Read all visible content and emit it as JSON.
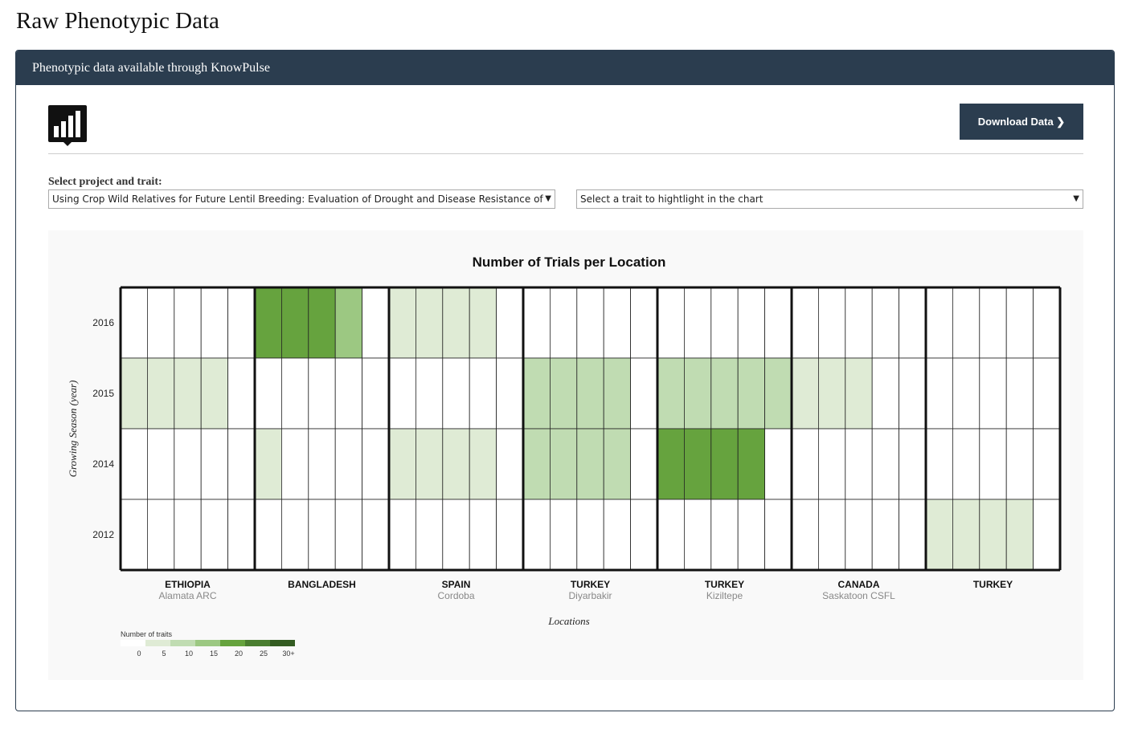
{
  "page": {
    "title": "Raw Phenotypic Data"
  },
  "panel": {
    "header": "Phenotypic data available through KnowPulse"
  },
  "toolbar": {
    "download_label": "Download Data ❯",
    "logo_icon": "bar-chart-icon"
  },
  "form": {
    "label": "Select project and trait:",
    "project_value": "Using Crop Wild Relatives for Future Lentil Breeding: Evaluation of Drought and Disease Resistance of",
    "trait_value": "Select a trait to hightlight in the chart"
  },
  "chart_data": {
    "type": "heatmap",
    "title": "Number of Trials per Location",
    "xlabel": "Locations",
    "ylabel": "Growing Season (year)",
    "years": [
      "2016",
      "2015",
      "2014",
      "2012"
    ],
    "columns_per_location": 5,
    "locations": [
      {
        "country": "ETHIOPIA",
        "site": "Alamata ARC",
        "values": [
          [
            0,
            0,
            0,
            0,
            0
          ],
          [
            5,
            5,
            5,
            5,
            0
          ],
          [
            0,
            0,
            0,
            0,
            0
          ],
          [
            0,
            0,
            0,
            0,
            0
          ]
        ]
      },
      {
        "country": "BANGLADESH",
        "site": "",
        "values": [
          [
            20,
            20,
            20,
            15,
            0
          ],
          [
            0,
            0,
            0,
            0,
            0
          ],
          [
            5,
            0,
            0,
            0,
            0
          ],
          [
            0,
            0,
            0,
            0,
            0
          ]
        ]
      },
      {
        "country": "SPAIN",
        "site": "Cordoba",
        "values": [
          [
            5,
            5,
            5,
            5,
            0
          ],
          [
            0,
            0,
            0,
            0,
            0
          ],
          [
            5,
            5,
            5,
            5,
            0
          ],
          [
            0,
            0,
            0,
            0,
            0
          ]
        ]
      },
      {
        "country": "TURKEY",
        "site": "Diyarbakir",
        "values": [
          [
            0,
            0,
            0,
            0,
            0
          ],
          [
            10,
            10,
            10,
            10,
            0
          ],
          [
            10,
            10,
            10,
            10,
            0
          ],
          [
            0,
            0,
            0,
            0,
            0
          ]
        ]
      },
      {
        "country": "TURKEY",
        "site": "Kiziltepe",
        "values": [
          [
            0,
            0,
            0,
            0,
            0
          ],
          [
            10,
            10,
            10,
            10,
            10
          ],
          [
            20,
            20,
            20,
            20,
            0
          ],
          [
            0,
            0,
            0,
            0,
            0
          ]
        ]
      },
      {
        "country": "CANADA",
        "site": "Saskatoon CSFL",
        "values": [
          [
            0,
            0,
            0,
            0,
            0
          ],
          [
            5,
            5,
            5,
            0,
            0
          ],
          [
            0,
            0,
            0,
            0,
            0
          ],
          [
            0,
            0,
            0,
            0,
            0
          ]
        ]
      },
      {
        "country": "TURKEY",
        "site": "",
        "values": [
          [
            0,
            0,
            0,
            0,
            0
          ],
          [
            0,
            0,
            0,
            0,
            0
          ],
          [
            0,
            0,
            0,
            0,
            0
          ],
          [
            5,
            5,
            5,
            5,
            0
          ]
        ]
      }
    ],
    "legend": {
      "title": "Number of traits",
      "bins": [
        {
          "label": "0",
          "min": 0,
          "color": "#ffffff"
        },
        {
          "label": "5",
          "min": 5,
          "color": "#dfebd5"
        },
        {
          "label": "10",
          "min": 10,
          "color": "#c0dcb2"
        },
        {
          "label": "15",
          "min": 15,
          "color": "#9cc882"
        },
        {
          "label": "20",
          "min": 20,
          "color": "#66a33e"
        },
        {
          "label": "25",
          "min": 25,
          "color": "#4a7e30"
        },
        {
          "label": "30+",
          "min": 30,
          "color": "#345c22"
        }
      ]
    }
  }
}
